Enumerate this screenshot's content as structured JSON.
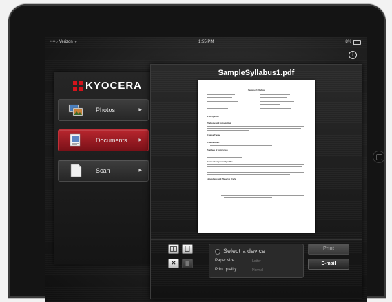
{
  "status_bar": {
    "carrier": "••••○ Verizon ᯤ",
    "time": "1:55 PM",
    "battery": "8%"
  },
  "info_icon": "i",
  "sidebar": {
    "logo_text": "KYOCERA",
    "items": [
      {
        "label": "Photos",
        "icon": "photos-icon",
        "active": false
      },
      {
        "label": "Documents",
        "icon": "documents-icon",
        "active": true
      },
      {
        "label": "Scan",
        "icon": "scan-icon",
        "active": false
      }
    ]
  },
  "document": {
    "filename": "SampleSyllabus1.pdf",
    "page_title": "Sample Syllabus",
    "headings": [
      "Prerequisites",
      "Welcome and Introduction",
      "Course Theme",
      "Course Goals",
      "Methods of Instruction",
      "Course Component Specifics",
      "Attendance and Make-Up Work"
    ]
  },
  "print_panel": {
    "device_placeholder": "Select a device",
    "paper_size_label": "Paper size",
    "paper_size_value": "Letter",
    "print_quality_label": "Print quality",
    "print_quality_value": "Normal",
    "print_button": "Print",
    "email_button": "E-mail",
    "close_symbol": "✕"
  },
  "colors": {
    "accent_red": "#b8262e",
    "background": "#1a1a1a"
  }
}
